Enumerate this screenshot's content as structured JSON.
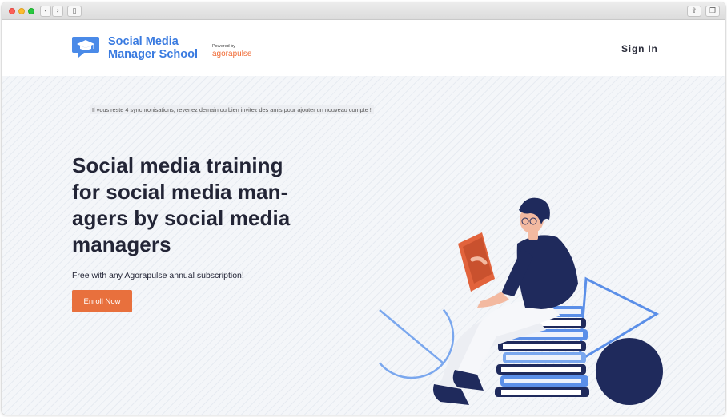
{
  "browser": {
    "back_glyph": "‹",
    "forward_glyph": "›",
    "sidebar_glyph": "▯",
    "share_glyph": "⇪",
    "tabs_glyph": "❐"
  },
  "header": {
    "brand_line1": "Social Media",
    "brand_line2": "Manager School",
    "powered_by": "Powered by",
    "partner": "agorapulse",
    "sign_in": "Sign In"
  },
  "notice": "Il vous reste 4 synchronisations, revenez demain ou bien invitez des amis pour ajouter un nouveau compte !",
  "hero": {
    "headline_lines": [
      "Social media training",
      "for social media man-",
      "agers by social media",
      "managers"
    ],
    "subtext": "Free with any Agorapulse annual subscription!",
    "cta": "Enroll Now"
  },
  "icons": {
    "logo": "graduation-cap-chat-bubble",
    "illustration": "person-reading-on-book-stack"
  },
  "colors": {
    "brand_blue": "#3a7be0",
    "cta_orange": "#e8703d",
    "agorapulse_orange": "#f06a34",
    "navy": "#1f2a5c",
    "text_dark": "#232536",
    "hero_bg": "#f4f6f9"
  }
}
